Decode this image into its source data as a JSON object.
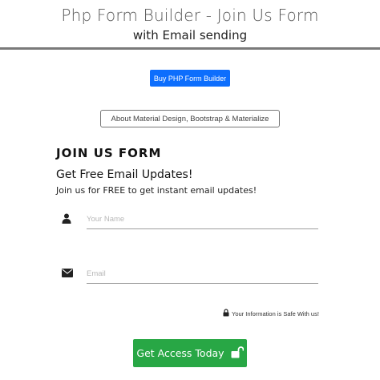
{
  "header": {
    "title": "Php Form Builder - Join Us Form",
    "subtitle": "with Email sending"
  },
  "buttons": {
    "buy_label": "Buy PHP Form Builder",
    "about_label": "About Material Design, Bootstrap & Materialize"
  },
  "form": {
    "title": "JOIN US FORM",
    "heading": "Get Free Email Updates!",
    "lead": "Join us for FREE to get instant email updates!",
    "name_field": {
      "placeholder": "Your Name",
      "value": "",
      "icon": "user-icon"
    },
    "email_field": {
      "placeholder": "Email",
      "value": "",
      "icon": "envelope-icon"
    },
    "safe_note": "Your Information is Safe With us!",
    "safe_icon": "lock-icon",
    "submit_label": "Get Access Today",
    "submit_icon": "unlock-icon"
  },
  "colors": {
    "primary": "#0d6efd",
    "success": "#28a745",
    "header_border": "#7a7a7a"
  }
}
